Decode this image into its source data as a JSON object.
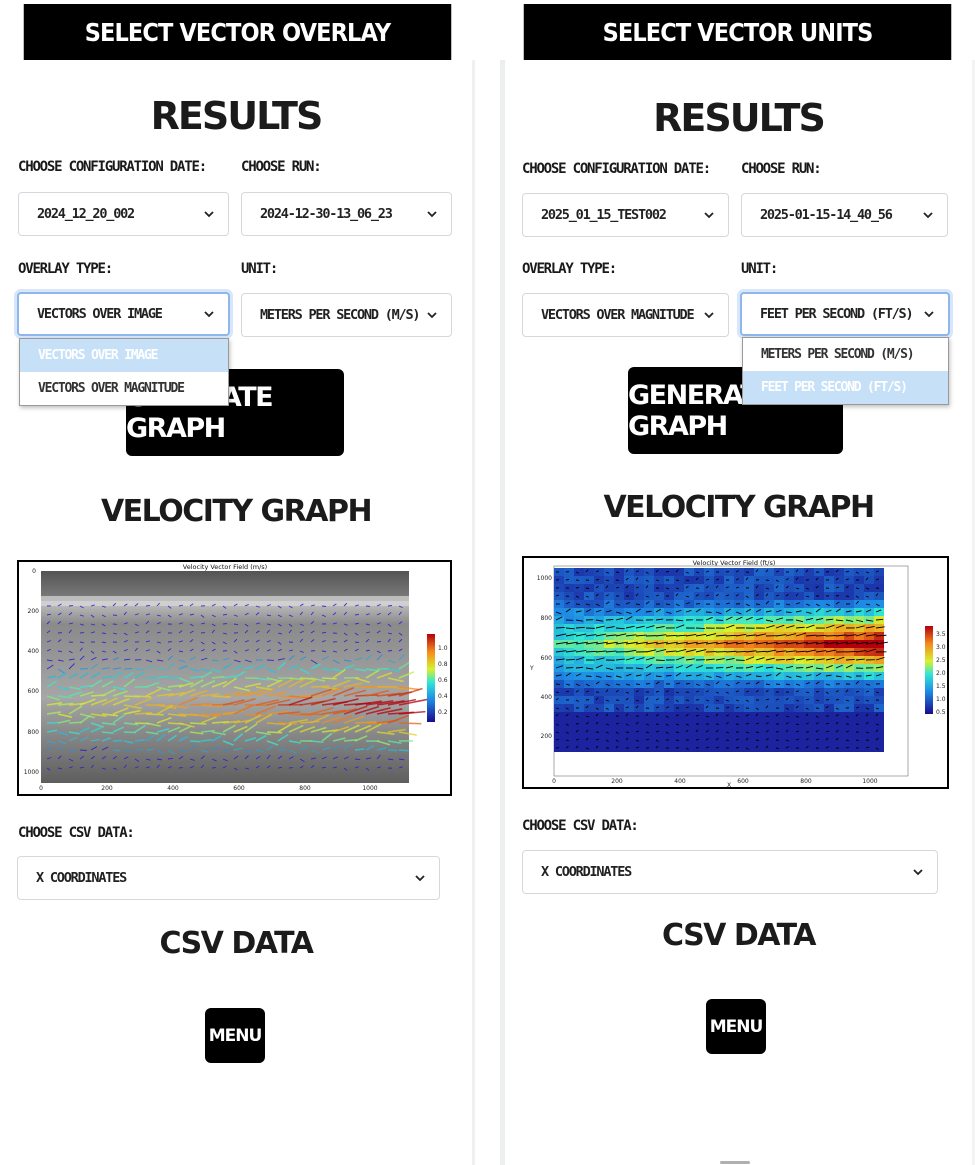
{
  "panels": [
    {
      "caption": "SELECT VECTOR OVERLAY",
      "results_title": "RESULTS",
      "config_label": "CHOOSE CONFIGURATION DATE:",
      "config_value": "2024_12_20_002",
      "run_label": "CHOOSE RUN:",
      "run_value": "2024-12-30-13_06_23",
      "overlay_label": "OVERLAY TYPE:",
      "overlay_value": "VECTORS OVER IMAGE",
      "unit_label": "UNIT:",
      "unit_value": "METERS PER SECOND (M/S)",
      "open_dropdown": [
        "VECTORS OVER IMAGE",
        "VECTORS OVER MAGNITUDE"
      ],
      "open_dropdown_selected": "VECTORS OVER IMAGE",
      "generate_label": "GENERATE GRAPH",
      "velocity_title": "VELOCITY GRAPH",
      "graph": {
        "title": "Velocity Vector Field (m/s)",
        "x_ticks": [
          "0",
          "200",
          "400",
          "600",
          "800",
          "1000"
        ],
        "y_ticks": [
          "0",
          "200",
          "400",
          "600",
          "800",
          "1000"
        ],
        "colorbar_ticks": [
          "1.0",
          "0.8",
          "0.6",
          "0.4",
          "0.2"
        ]
      },
      "csv_label": "CHOOSE CSV DATA:",
      "csv_value": "X COORDINATES",
      "csv_title": "CSV DATA",
      "menu_label": "MENU"
    },
    {
      "caption": "SELECT VECTOR UNITS",
      "results_title": "RESULTS",
      "config_label": "CHOOSE CONFIGURATION DATE:",
      "config_value": "2025_01_15_TEST002",
      "run_label": "CHOOSE RUN:",
      "run_value": "2025-01-15-14_40_56",
      "overlay_label": "OVERLAY TYPE:",
      "overlay_value": "VECTORS OVER MAGNITUDE",
      "unit_label": "UNIT:",
      "unit_value": "FEET PER SECOND (FT/S)",
      "open_dropdown": [
        "METERS PER SECOND (M/S)",
        "FEET PER SECOND (FT/S)"
      ],
      "open_dropdown_selected": "FEET PER SECOND (FT/S)",
      "generate_label": "GENERATE GRAPH",
      "velocity_title": "VELOCITY GRAPH",
      "graph": {
        "title": "Velocity Vector Field (ft/s)",
        "x_label": "X",
        "y_label": "Y",
        "x_ticks": [
          "0",
          "200",
          "400",
          "600",
          "800",
          "1000"
        ],
        "y_ticks": [
          "1000",
          "800",
          "600",
          "400",
          "200"
        ],
        "colorbar_ticks": [
          "3.5",
          "3.0",
          "2.5",
          "2.0",
          "1.5",
          "1.0",
          "0.5"
        ]
      },
      "csv_label": "CHOOSE CSV DATA:",
      "csv_value": "X COORDINATES",
      "csv_title": "CSV DATA",
      "menu_label": "MENU"
    }
  ],
  "colors": {
    "accent_black": "#000000",
    "focus_blue": "#8fb7ec",
    "option_highlight": "#c6e0f7",
    "field_border": "#d4d8dc"
  },
  "icons": [
    "chevron-down-icon"
  ]
}
